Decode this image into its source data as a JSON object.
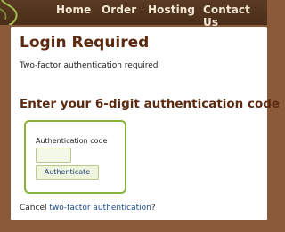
{
  "nav": {
    "items": [
      {
        "label": "Home"
      },
      {
        "label": "Order"
      },
      {
        "label": "Hosting"
      },
      {
        "label": "Contact Us"
      }
    ]
  },
  "main": {
    "title": "Login Required",
    "subtitle": "Two-factor authentication required",
    "heading": "Enter your 6-digit authentication code",
    "form": {
      "code_label": "Authentication code",
      "code_value": "",
      "submit_label": "Authenticate"
    },
    "cancel": {
      "prefix": "Cancel ",
      "link_text": "two-factor authentication",
      "suffix": "?"
    }
  },
  "colors": {
    "page_background": "#8a5a3a",
    "nav_background": "#4a2e19",
    "heading": "#5b2a10",
    "form_border": "#86b33a",
    "link": "#1d4c8a"
  }
}
